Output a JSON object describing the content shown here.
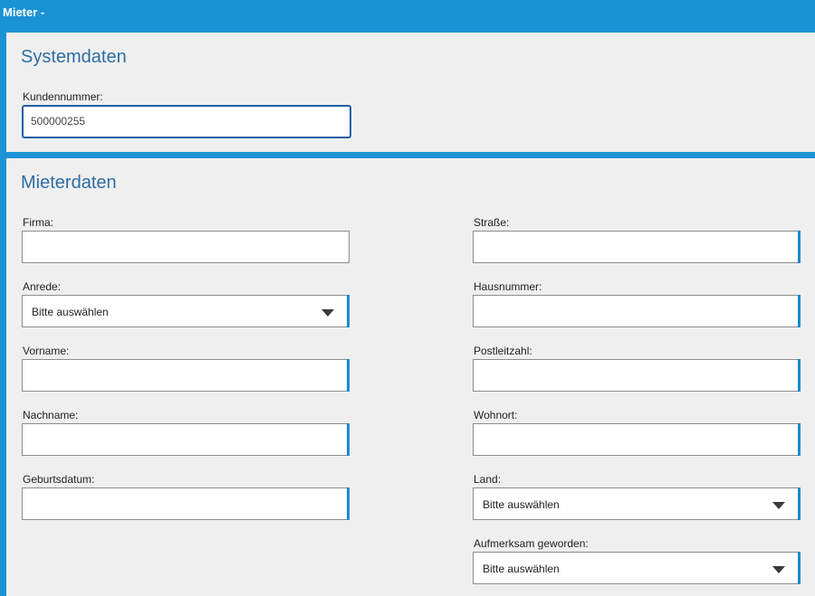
{
  "window": {
    "title": "Mieter -"
  },
  "systemdaten": {
    "heading": "Systemdaten",
    "kundennummer": {
      "label": "Kundennummer:",
      "value": "500000255"
    }
  },
  "mieterdaten": {
    "heading": "Mieterdaten",
    "firma": {
      "label": "Firma:",
      "value": ""
    },
    "anrede": {
      "label": "Anrede:",
      "value": "Bitte auswählen"
    },
    "vorname": {
      "label": "Vorname:",
      "value": ""
    },
    "nachname": {
      "label": "Nachname:",
      "value": ""
    },
    "geburtsdatum": {
      "label": "Geburtsdatum:",
      "value": ""
    },
    "strasse": {
      "label": "Straße:",
      "value": ""
    },
    "hausnummer": {
      "label": "Hausnummer:",
      "value": ""
    },
    "postleitzahl": {
      "label": "Postleitzahl:",
      "value": ""
    },
    "wohnort": {
      "label": "Wohnort:",
      "value": ""
    },
    "land": {
      "label": "Land:",
      "value": "Bitte auswählen"
    },
    "aufmerksam": {
      "label": "Aufmerksam geworden:",
      "value": "Bitte auswählen"
    }
  },
  "colors": {
    "accent": "#1a93d4",
    "heading": "#2e6da4",
    "panel": "#efefef"
  },
  "icons": {
    "dropdown": "caret-down-icon"
  }
}
